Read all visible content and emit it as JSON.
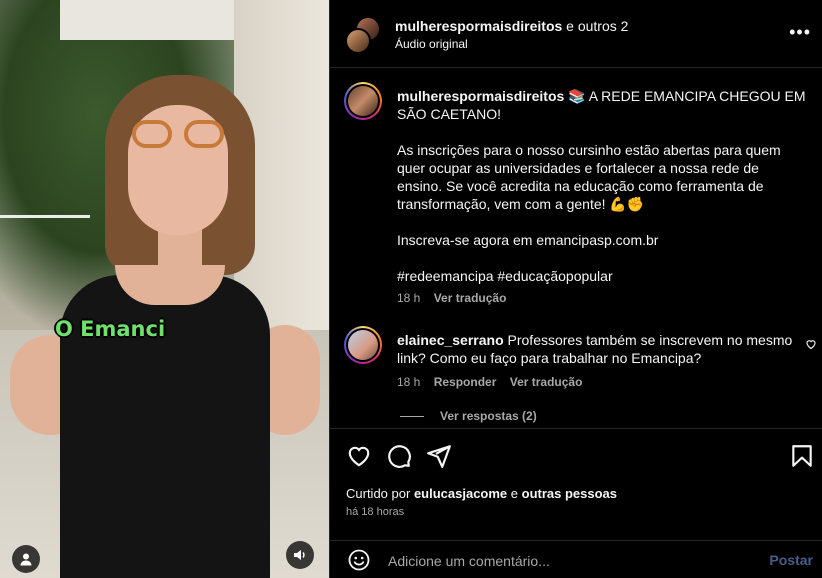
{
  "media": {
    "caption_overlay": "O Emanci"
  },
  "header": {
    "username": "mulherespormaisdireitos",
    "others": "e outros 2",
    "audio": "Áudio original",
    "more": "•••"
  },
  "post": {
    "username": "mulherespormaisdireitos",
    "headline": "📚 A REDE EMANCIPA CHEGOU EM SÃO CAETANO!",
    "paragraph1": "As inscrições para o nosso cursinho estão abertas para quem quer ocupar as universidades e fortalecer a nossa rede de ensino. Se você acredita na educação como ferramenta de transformação, vem com a gente! 💪✊",
    "paragraph2": "Inscreva-se agora em emancipasp.com.br",
    "hashtags": "#redeemancipa #educaçãopopular",
    "time": "18 h",
    "translate": "Ver tradução"
  },
  "comment": {
    "username": "elainec_serrano",
    "text": "Professores também se inscrevem no mesmo link? Como eu faço para trabalhar no Emancipa?",
    "time": "18 h",
    "reply": "Responder",
    "translate": "Ver tradução",
    "view_replies": "Ver respostas (2)"
  },
  "actions": {
    "liked_prefix": "Curtido por",
    "liked_user": "eulucasjacome",
    "liked_and": "e",
    "liked_others": "outras pessoas",
    "time_ago": "há 18 horas"
  },
  "add_comment": {
    "placeholder": "Adicione um comentário...",
    "post_label": "Postar"
  },
  "colors": {
    "background": "#000000",
    "text": "#f5f5f5",
    "muted": "#a8a8a8",
    "post_button": "#4a5d85",
    "caption_green": "#6ee06b"
  }
}
